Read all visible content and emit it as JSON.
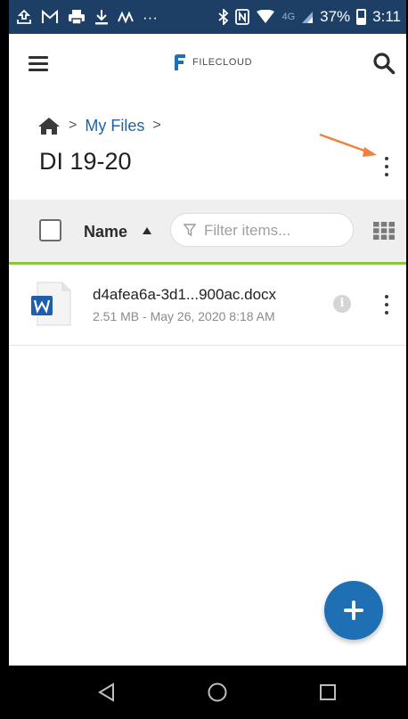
{
  "status_bar": {
    "left_icons": [
      "upload-icon",
      "gmail-icon",
      "printer-icon",
      "download-icon",
      "notification-icon",
      "more-dots-icon"
    ],
    "right_icons": [
      "bluetooth-icon",
      "nfc-icon",
      "wifi-icon",
      "lte-signal-icon",
      "battery-icon"
    ],
    "network": "4G",
    "battery": "37%",
    "time": "3:11",
    "colors": {
      "background": "#1d3f66"
    }
  },
  "app_bar": {
    "logo_text": "FILECLOUD"
  },
  "breadcrumb": {
    "separator": ">",
    "items": [
      "My Files"
    ]
  },
  "page": {
    "title": "DI 19-20"
  },
  "toolbar": {
    "column_name": "Name",
    "filter_placeholder": "Filter items...",
    "colors": {
      "background": "#efefef",
      "accent_underline": "#8cc63f"
    }
  },
  "files": [
    {
      "name": "d4afea6a-3d1...900ac.docx",
      "meta": "2.51 MB - May 26, 2020 8:18 AM",
      "icon": "word-doc-icon"
    }
  ],
  "colors": {
    "accent_blue": "#1f62a6",
    "fab": "#1f6fb5",
    "annotation_arrow": "#f0803c"
  }
}
